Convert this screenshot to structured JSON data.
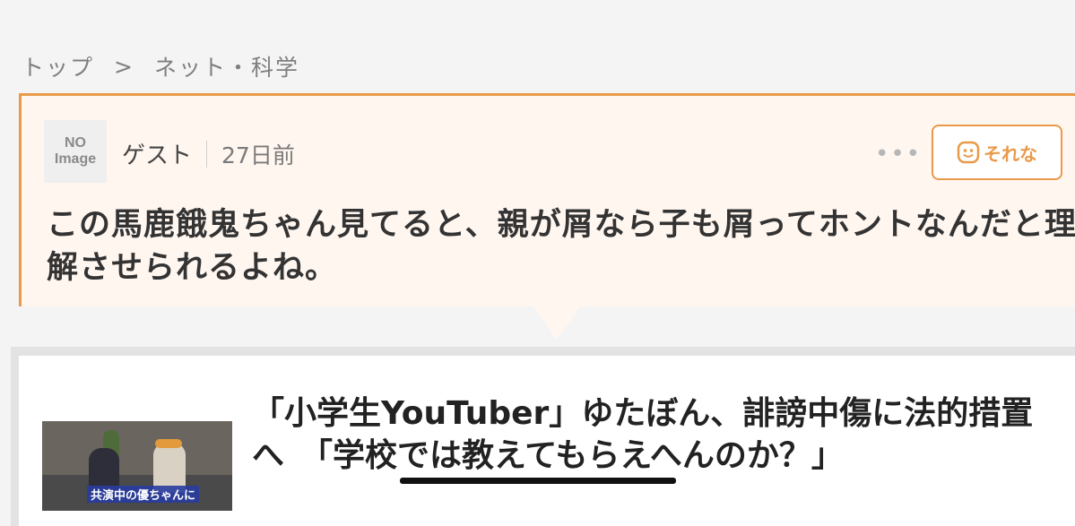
{
  "breadcrumb": {
    "home": "トップ",
    "separator": ">",
    "category": "ネット・科学"
  },
  "comment_card": {
    "avatar_line1": "NO",
    "avatar_line2": "Image",
    "user": "ゲスト",
    "time": "27日前",
    "more": "•••",
    "reaction_label": "それな",
    "text": "この馬鹿餓鬼ちゃん見てると、親が屑なら子も屑ってホントなんだと理解させられるよね。"
  },
  "article": {
    "thumbnail_caption": "共演中の優ちゃんに",
    "headline": "「小学生YouTuber」ゆたぼん、誹謗中傷に法的措置へ　「学校では教えてもらえへんのか？」"
  },
  "colors": {
    "accent": "#e89a4a",
    "card_bg": "#fff6f0"
  }
}
